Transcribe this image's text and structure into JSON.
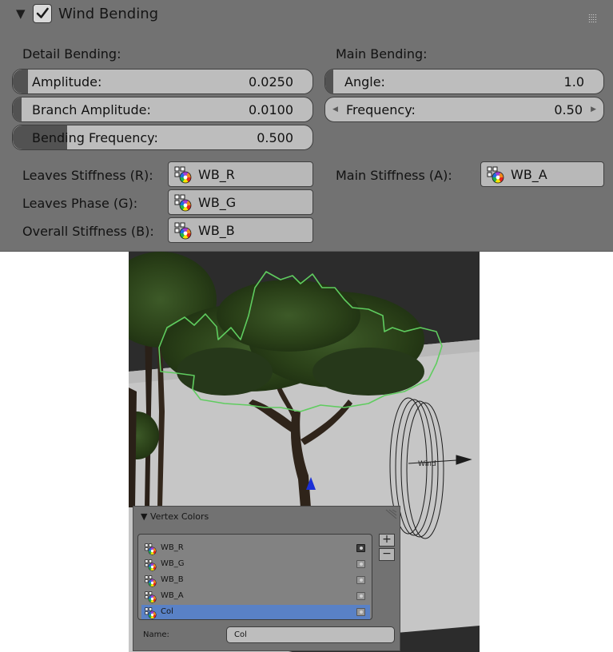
{
  "panel": {
    "title": "Wind Bending",
    "enabled": true,
    "detail": {
      "heading": "Detail Bending:",
      "amplitude": {
        "label": "Amplitude:",
        "value": "0.0250",
        "fill": 0.05
      },
      "branch_amplitude": {
        "label": "Branch Amplitude:",
        "value": "0.0100",
        "fill": 0.03
      },
      "bending_frequency": {
        "label": "Bending Frequency:",
        "value": "0.500",
        "fill": 0.18
      }
    },
    "main": {
      "heading": "Main Bending:",
      "angle": {
        "label": "Angle:",
        "value": "1.0",
        "fill": 0.03
      },
      "frequency": {
        "label": "Frequency:",
        "value": "0.50"
      }
    },
    "stiffness": {
      "leaves_stiffness": {
        "label": "Leaves Stiffness (R):",
        "value": "WB_R"
      },
      "leaves_phase": {
        "label": "Leaves Phase (G):",
        "value": "WB_G"
      },
      "overall_stiffness": {
        "label": "Overall Stiffness (B):",
        "value": "WB_B"
      },
      "main_stiffness": {
        "label": "Main Stiffness (A):",
        "value": "WB_A"
      }
    }
  },
  "viewport": {
    "wind_label": "Wind"
  },
  "vertex_colors": {
    "title": "Vertex Colors",
    "items": [
      {
        "name": "WB_R",
        "active_render": true,
        "selected": false
      },
      {
        "name": "WB_G",
        "active_render": false,
        "selected": false
      },
      {
        "name": "WB_B",
        "active_render": false,
        "selected": false
      },
      {
        "name": "WB_A",
        "active_render": false,
        "selected": false
      },
      {
        "name": "Col",
        "active_render": false,
        "selected": true
      }
    ],
    "add_label": "+",
    "remove_label": "−",
    "name_label": "Name:",
    "name_value": "Col"
  }
}
